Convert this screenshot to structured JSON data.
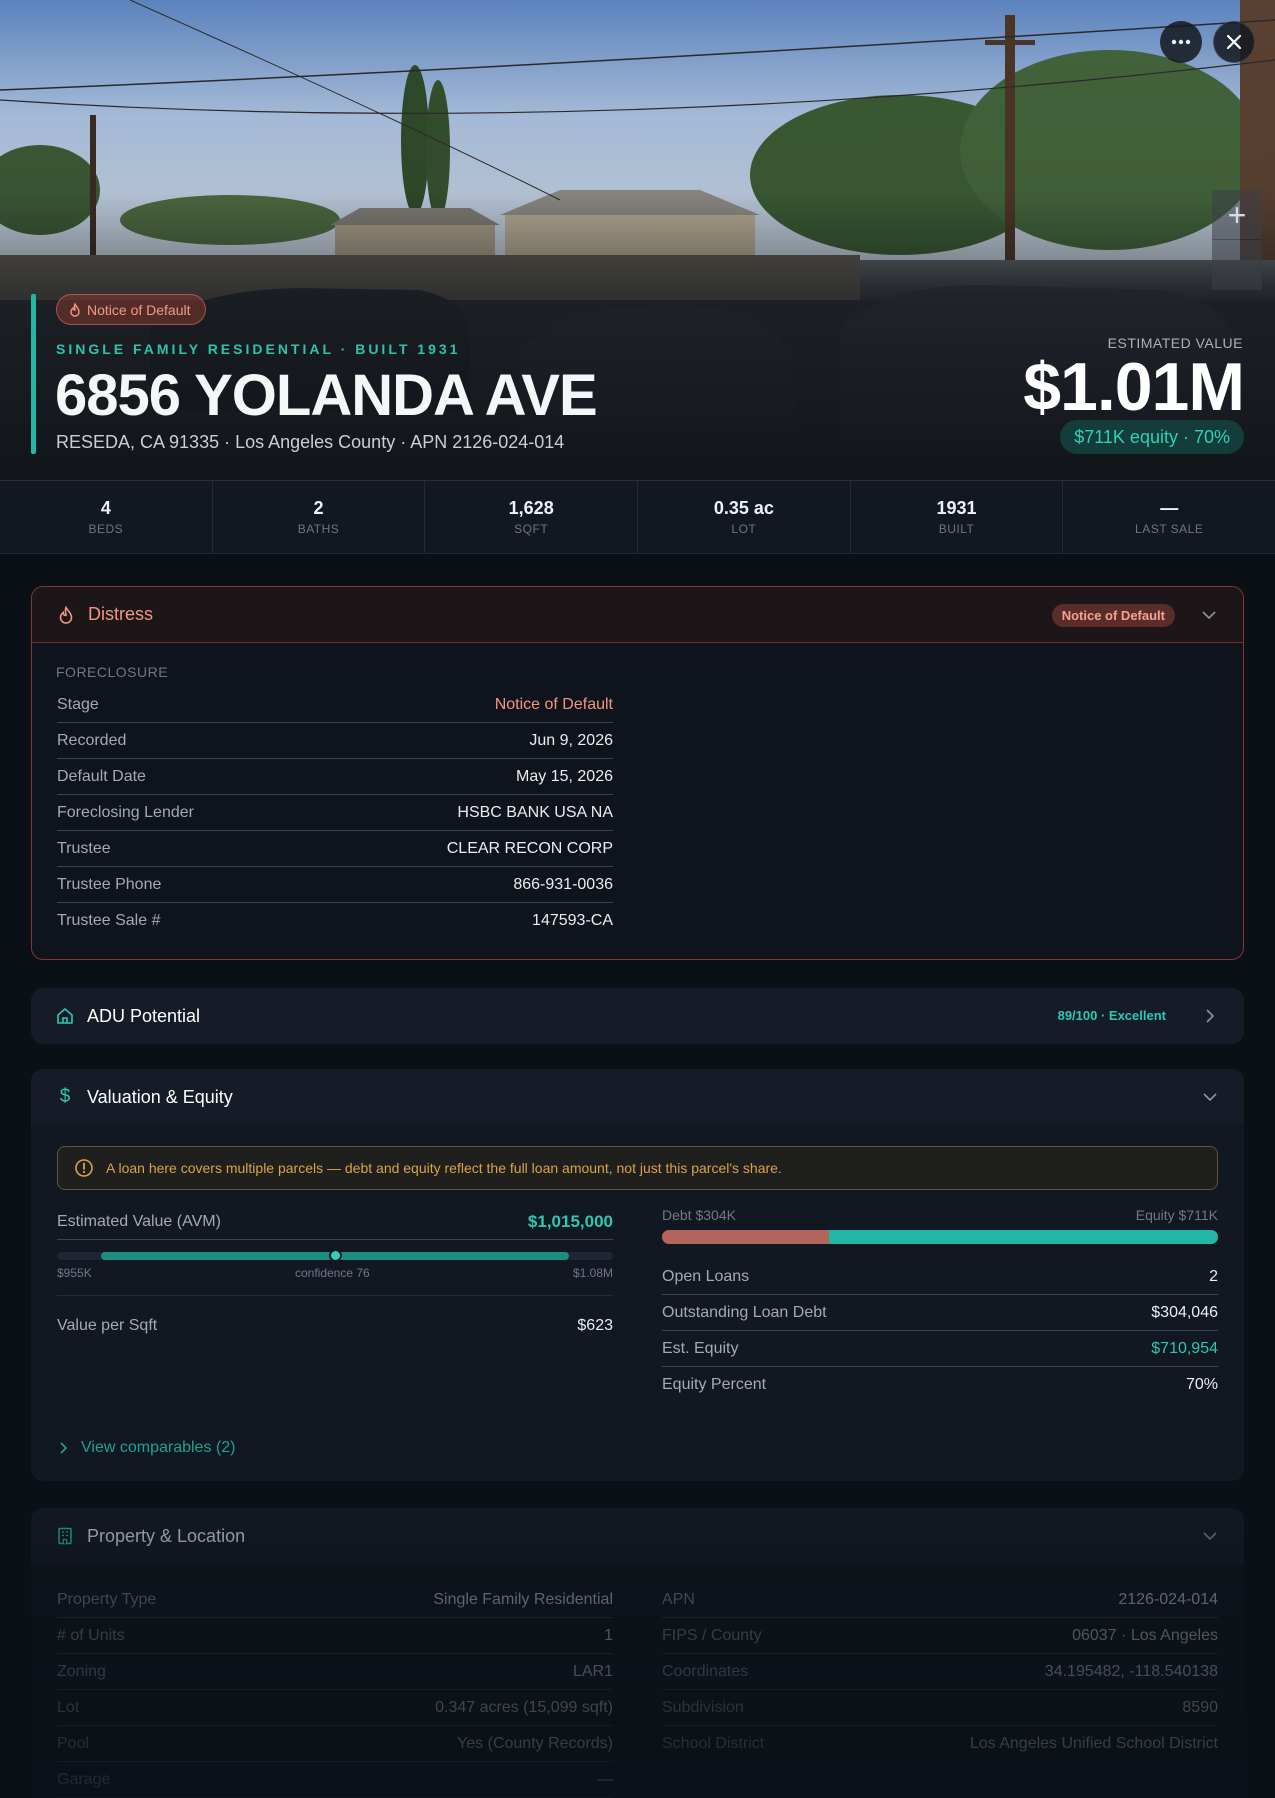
{
  "hero": {
    "status_badge": "Notice of Default",
    "subtitle": "SINGLE FAMILY RESIDENTIAL · BUILT 1931",
    "title": "6856 YOLANDA AVE",
    "address": "RESEDA, CA 91335 · Los Angeles County · APN 2126-024-014",
    "estimated_label": "ESTIMATED VALUE",
    "estimated_value": "$1.01M",
    "equity_pill": "$711K equity · 70%"
  },
  "stats": [
    {
      "value": "4",
      "label": "BEDS"
    },
    {
      "value": "2",
      "label": "BATHS"
    },
    {
      "value": "1,628",
      "label": "SQFT"
    },
    {
      "value": "0.35 ac",
      "label": "LOT"
    },
    {
      "value": "1931",
      "label": "BUILT"
    },
    {
      "value": "—",
      "label": "LAST SALE"
    }
  ],
  "distress": {
    "title": "Distress",
    "badge": "Notice of Default",
    "section_label": "FORECLOSURE",
    "rows": [
      {
        "key": "Stage",
        "value": "Notice of Default"
      },
      {
        "key": "Recorded",
        "value": "Jun 9, 2026"
      },
      {
        "key": "Default Date",
        "value": "May 15, 2026"
      },
      {
        "key": "Foreclosing Lender",
        "value": "HSBC BANK USA NA"
      },
      {
        "key": "Trustee",
        "value": "CLEAR RECON CORP"
      },
      {
        "key": "Trustee Phone",
        "value": "866-931-0036"
      },
      {
        "key": "Trustee Sale #",
        "value": "147593-CA"
      }
    ]
  },
  "adu": {
    "title": "ADU Potential",
    "score": "89/100 · Excellent"
  },
  "valuation": {
    "title": "Valuation & Equity",
    "warning": "A loan here covers multiple parcels — debt and equity reflect the full loan amount, not just this parcel's share.",
    "avm_label": "Estimated Value (AVM)",
    "avm_value": "$1,015,000",
    "range_low": "$955K",
    "range_mid": "confidence 76",
    "range_high": "$1.08M",
    "range_fill_start_pct": 8,
    "range_fill_end_pct": 92,
    "range_point_pct": 50,
    "value_per_sqft_label": "Value per Sqft",
    "value_per_sqft": "$623",
    "debt_label": "Debt $304K",
    "equity_label": "Equity $711K",
    "debt_share_pct": 30,
    "equity_share_pct": 70,
    "rows": [
      {
        "key": "Open Loans",
        "value": "2"
      },
      {
        "key": "Outstanding Loan Debt",
        "value": "$304,046"
      },
      {
        "key": "Est. Equity",
        "value": "$710,954"
      },
      {
        "key": "Equity Percent",
        "value": "70%"
      }
    ],
    "comps_link": "View comparables (2)"
  },
  "property": {
    "title": "Property & Location",
    "left_rows": [
      {
        "key": "Property Type",
        "value": "Single Family Residential"
      },
      {
        "key": "# of Units",
        "value": "1"
      },
      {
        "key": "Zoning",
        "value": "LAR1"
      },
      {
        "key": "Lot",
        "value": "0.347 acres (15,099 sqft)"
      },
      {
        "key": "Pool",
        "value": "Yes (County Records)"
      },
      {
        "key": "Garage",
        "value": "—"
      }
    ],
    "right_rows": [
      {
        "key": "APN",
        "value": "2126-024-014"
      },
      {
        "key": "FIPS / County",
        "value": "06037 · Los Angeles"
      },
      {
        "key": "Coordinates",
        "value": "34.195482, -118.540138"
      },
      {
        "key": "Subdivision",
        "value": "8590"
      },
      {
        "key": "School District",
        "value": "Los Angeles Unified School District"
      }
    ]
  },
  "colors": {
    "accent": "#22b8a5",
    "distress": "#f29580",
    "warning": "#d9a34a",
    "background": "#0b0f16"
  }
}
